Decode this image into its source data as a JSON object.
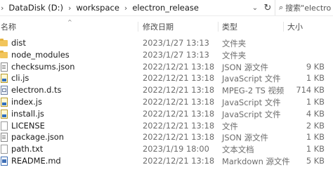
{
  "address": {
    "path": [
      "DataDisk (D:)",
      "workspace",
      "electron_release"
    ],
    "search_placeholder": "搜索\"electro"
  },
  "columns": {
    "name": "名称",
    "date": "修改日期",
    "type": "类型",
    "size": "大小"
  },
  "files": [
    {
      "name": "dist",
      "date": "2023/1/27 13:13",
      "type": "文件夹",
      "size": "",
      "icon": "folder-icon"
    },
    {
      "name": "node_modules",
      "date": "2023/1/27 13:13",
      "type": "文件夹",
      "size": "",
      "icon": "folder-icon"
    },
    {
      "name": "checksums.json",
      "date": "2022/12/21 13:18",
      "type": "JSON 源文件",
      "size": "9 KB",
      "icon": "json-file-icon"
    },
    {
      "name": "cli.js",
      "date": "2022/12/21 13:18",
      "type": "JavaScript 文件",
      "size": "1 KB",
      "icon": "js-file-icon"
    },
    {
      "name": "electron.d.ts",
      "date": "2022/12/21 13:18",
      "type": "MPEG-2 TS 视频",
      "size": "714 KB",
      "icon": "ts-file-icon"
    },
    {
      "name": "index.js",
      "date": "2022/12/21 13:18",
      "type": "JavaScript 文件",
      "size": "1 KB",
      "icon": "js-file-icon"
    },
    {
      "name": "install.js",
      "date": "2022/12/21 13:18",
      "type": "JavaScript 文件",
      "size": "4 KB",
      "icon": "js-file-icon"
    },
    {
      "name": "LICENSE",
      "date": "2022/12/21 13:18",
      "type": "文件",
      "size": "2 KB",
      "icon": "file-icon"
    },
    {
      "name": "package.json",
      "date": "2022/12/21 13:18",
      "type": "JSON 源文件",
      "size": "1 KB",
      "icon": "json-file-icon"
    },
    {
      "name": "path.txt",
      "date": "2023/1/19 18:00",
      "type": "文本文档",
      "size": "1 KB",
      "icon": "text-file-icon"
    },
    {
      "name": "README.md",
      "date": "2022/12/21 13:18",
      "type": "Markdown 源文件",
      "size": "5 KB",
      "icon": "markdown-file-icon"
    }
  ]
}
